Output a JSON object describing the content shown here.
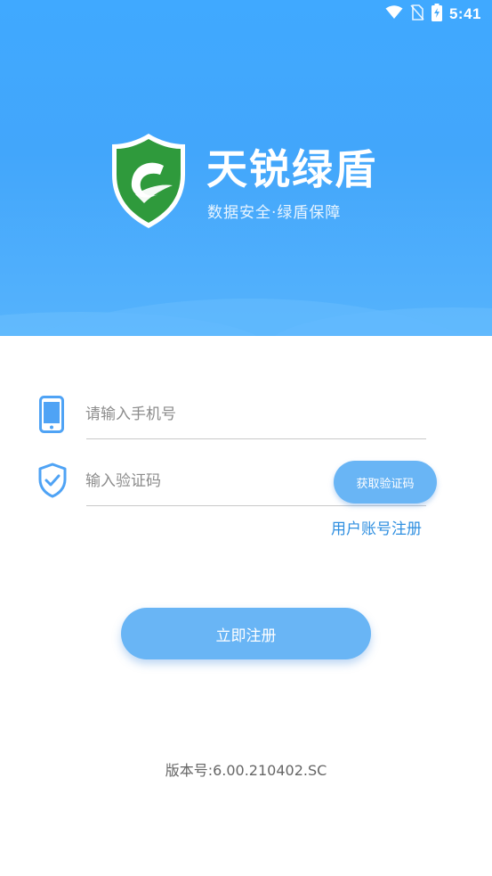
{
  "status_bar": {
    "time": "5:41",
    "icons": [
      "wifi-icon",
      "no-sim-icon",
      "battery-charging-icon"
    ]
  },
  "brand": {
    "title": "天锐绿盾",
    "slogan": "数据安全·绿盾保障",
    "logo_icon": "green-shield-logo-icon"
  },
  "form": {
    "phone": {
      "icon": "smartphone-icon",
      "placeholder": "请输入手机号",
      "value": ""
    },
    "code": {
      "icon": "shield-check-icon",
      "placeholder": "输入验证码",
      "value": ""
    },
    "get_code_label": "获取验证码",
    "register_link": "用户账号注册",
    "submit_label": "立即注册"
  },
  "footer": {
    "version_label": "版本号:",
    "version_value": "6.00.210402.SC"
  },
  "colors": {
    "header_blue": "#40a9ff",
    "button_blue": "#69b5f5",
    "link_blue": "#2f8fe0",
    "logo_green": "#2f9a3c"
  }
}
